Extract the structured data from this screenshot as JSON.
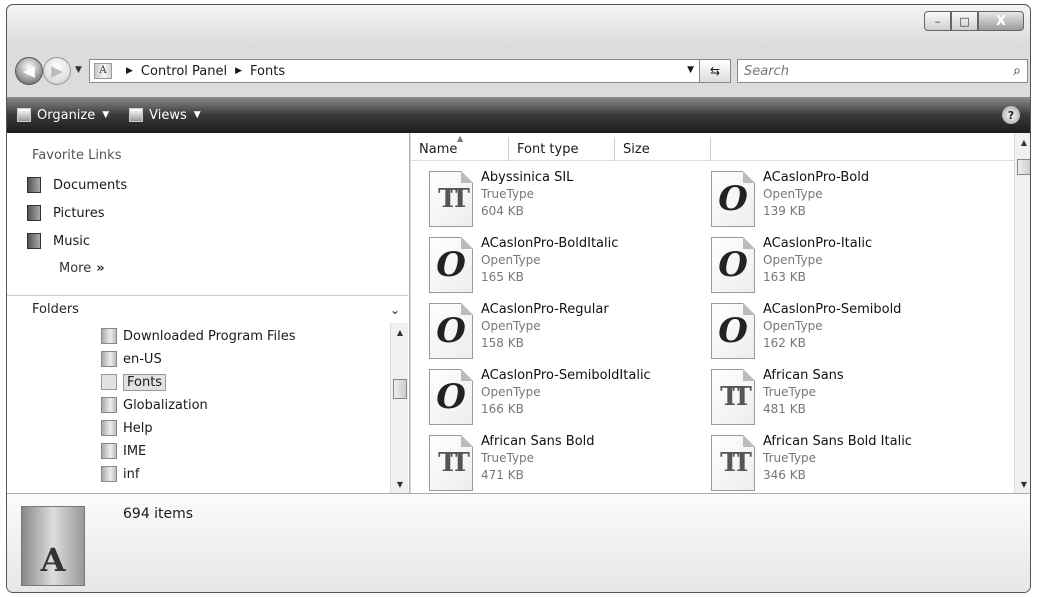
{
  "window": {
    "caption_buttons": {
      "minimize": "–",
      "maximize": "□",
      "close": "X"
    }
  },
  "address": {
    "path": [
      "Control Panel",
      "Fonts"
    ],
    "search_placeholder": "Search"
  },
  "toolbar": {
    "organize": "Organize",
    "views": "Views",
    "help": "?"
  },
  "left_pane": {
    "favorites_heading": "Favorite Links",
    "favorites": [
      "Documents",
      "Pictures",
      "Music"
    ],
    "more": "More",
    "folders_heading": "Folders",
    "tree": [
      "Downloaded Program Files",
      "en-US",
      "Fonts",
      "Globalization",
      "Help",
      "IME",
      "inf"
    ],
    "selected": "Fonts"
  },
  "columns": [
    "Name",
    "Font type",
    "Size"
  ],
  "fonts": [
    {
      "name": "Abyssinica SIL",
      "type": "TrueType",
      "size": "604 KB",
      "icon": "truetype-icon"
    },
    {
      "name": "ACaslonPro-Bold",
      "type": "OpenType",
      "size": "139 KB",
      "icon": "opentype-icon"
    },
    {
      "name": "ACaslonPro-BoldItalic",
      "type": "OpenType",
      "size": "165 KB",
      "icon": "opentype-icon"
    },
    {
      "name": "ACaslonPro-Italic",
      "type": "OpenType",
      "size": "163 KB",
      "icon": "opentype-icon"
    },
    {
      "name": "ACaslonPro-Regular",
      "type": "OpenType",
      "size": "158 KB",
      "icon": "opentype-icon"
    },
    {
      "name": "ACaslonPro-Semibold",
      "type": "OpenType",
      "size": "162 KB",
      "icon": "opentype-icon"
    },
    {
      "name": "ACaslonPro-SemiboldItalic",
      "type": "OpenType",
      "size": "166 KB",
      "icon": "opentype-icon"
    },
    {
      "name": "African Sans",
      "type": "TrueType",
      "size": "481 KB",
      "icon": "truetype-icon"
    },
    {
      "name": "African Sans Bold",
      "type": "TrueType",
      "size": "471 KB",
      "icon": "truetype-icon"
    },
    {
      "name": "African Sans Bold Italic",
      "type": "TrueType",
      "size": "346 KB",
      "icon": "truetype-icon"
    }
  ],
  "details": {
    "count": "694 items"
  }
}
